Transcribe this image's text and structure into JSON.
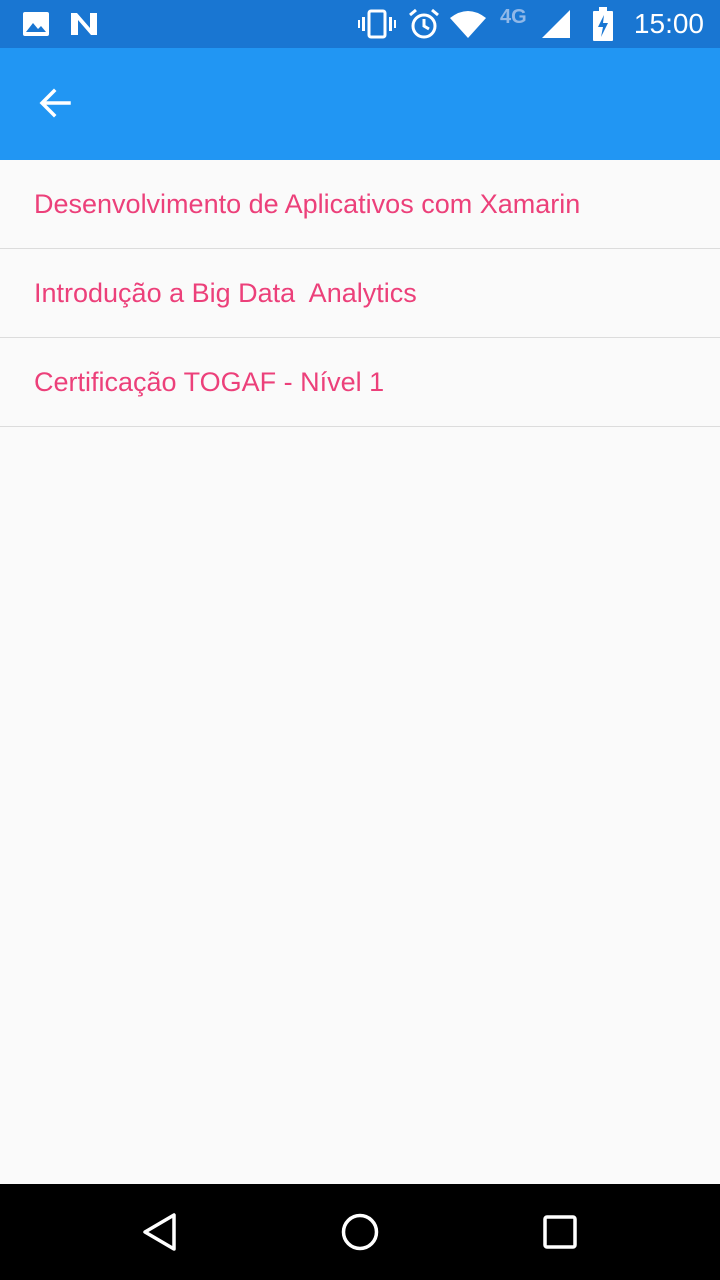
{
  "status_bar": {
    "time": "15:00",
    "network": "4G",
    "icons": [
      "image-icon",
      "n-notification-icon",
      "vibrate-icon",
      "alarm-icon",
      "wifi-icon",
      "signal-icon",
      "battery-charging-icon"
    ]
  },
  "app_bar": {
    "back_icon": "arrow-back-icon",
    "color": "#2196f3"
  },
  "courses": [
    {
      "title": "Desenvolvimento de Aplicativos com Xamarin"
    },
    {
      "title": "Introdução a Big Data  Analytics"
    },
    {
      "title": "Certificação TOGAF - Nível 1"
    }
  ],
  "colors": {
    "status_bar": "#1976d2",
    "item_text": "#ec407a",
    "background": "#fafafa"
  },
  "nav_bar": {
    "icons": [
      "back-triangle-icon",
      "home-circle-icon",
      "recents-square-icon"
    ]
  }
}
